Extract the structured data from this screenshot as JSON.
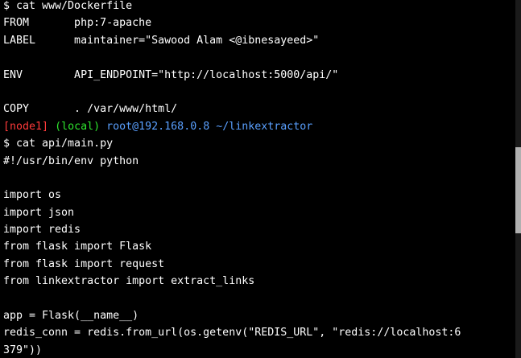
{
  "terminal": {
    "lines": [
      {
        "segments": [
          {
            "text": "$ cat www/Dockerfile",
            "color": "white"
          }
        ]
      },
      {
        "segments": [
          {
            "text": "FROM       php:7-apache",
            "color": "white"
          }
        ]
      },
      {
        "segments": [
          {
            "text": "LABEL      maintainer=\"Sawood Alam <@ibnesayeed>\"",
            "color": "white"
          }
        ]
      },
      {
        "segments": [
          {
            "text": "",
            "color": "white"
          }
        ]
      },
      {
        "segments": [
          {
            "text": "ENV        API_ENDPOINT=\"http://localhost:5000/api/\"",
            "color": "white"
          }
        ]
      },
      {
        "segments": [
          {
            "text": "",
            "color": "white"
          }
        ]
      },
      {
        "segments": [
          {
            "text": "COPY       . /var/www/html/",
            "color": "white"
          }
        ]
      },
      {
        "segments": [
          {
            "text": "[node1]",
            "color": "red"
          },
          {
            "text": " ",
            "color": "white"
          },
          {
            "text": "(local)",
            "color": "green"
          },
          {
            "text": " ",
            "color": "white"
          },
          {
            "text": "root@192.168.0.8 ~/linkextractor",
            "color": "cyan"
          }
        ]
      },
      {
        "segments": [
          {
            "text": "$ cat api/main.py",
            "color": "white"
          }
        ]
      },
      {
        "segments": [
          {
            "text": "#!/usr/bin/env python",
            "color": "white"
          }
        ]
      },
      {
        "segments": [
          {
            "text": "",
            "color": "white"
          }
        ]
      },
      {
        "segments": [
          {
            "text": "import os",
            "color": "white"
          }
        ]
      },
      {
        "segments": [
          {
            "text": "import json",
            "color": "white"
          }
        ]
      },
      {
        "segments": [
          {
            "text": "import redis",
            "color": "white"
          }
        ]
      },
      {
        "segments": [
          {
            "text": "from flask import Flask",
            "color": "white"
          }
        ]
      },
      {
        "segments": [
          {
            "text": "from flask import request",
            "color": "white"
          }
        ]
      },
      {
        "segments": [
          {
            "text": "from linkextractor import extract_links",
            "color": "white"
          }
        ]
      },
      {
        "segments": [
          {
            "text": "",
            "color": "white"
          }
        ]
      },
      {
        "segments": [
          {
            "text": "app = Flask(__name__)",
            "color": "white"
          }
        ]
      },
      {
        "segments": [
          {
            "text": "redis_conn = redis.from_url(os.getenv(\"REDIS_URL\", \"redis://localhost:6",
            "color": "white"
          }
        ]
      },
      {
        "segments": [
          {
            "text": "379\"))",
            "color": "white"
          }
        ]
      }
    ]
  },
  "colors": {
    "background": "#000000",
    "white": "#ffffff",
    "red": "#ff3a3a",
    "green": "#2ee62e",
    "cyan": "#5aa0ff",
    "scrollbar_track": "#1a1a1a",
    "scrollbar_thumb": "#b0b0b0"
  }
}
